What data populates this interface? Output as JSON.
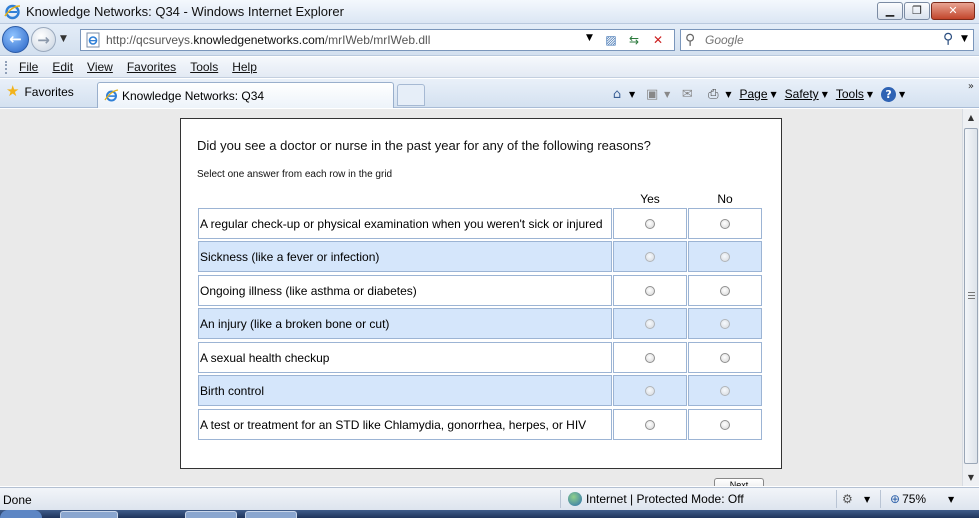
{
  "window": {
    "title": "Knowledge Networks: Q34 - Windows Internet Explorer",
    "min_glyph": "▁",
    "max_glyph": "❐",
    "close_glyph": "✕"
  },
  "address": {
    "url_prefix": "http://qcsurveys.",
    "url_domain": "knowledgenetworks.com",
    "url_path": "/mrIWeb/mrIWeb.dll",
    "search_placeholder": "Google"
  },
  "menu": [
    "File",
    "Edit",
    "View",
    "Favorites",
    "Tools",
    "Help"
  ],
  "favorites_label": "Favorites",
  "tab_title": "Knowledge Networks: Q34",
  "commands": {
    "page": "Page",
    "safety": "Safety",
    "tools": "Tools"
  },
  "survey": {
    "question": "Did you see a doctor or nurse in the past year for any of the following reasons?",
    "instruction": "Select one answer from each row in the grid",
    "columns": [
      "Yes",
      "No"
    ],
    "rows": [
      "A regular check-up or physical examination when you weren't sick or injured",
      "Sickness (like a fever or infection)",
      "Ongoing illness (like asthma or diabetes)",
      "An injury (like a broken bone or cut)",
      "A sexual health checkup",
      "Birth control",
      "A test or treatment for an STD like Chlamydia, gonorrhea, herpes, or HIV"
    ],
    "next_label": "Next"
  },
  "statusbar": {
    "status": "Done",
    "zone": "Internet | Protected Mode: Off",
    "zoom": "75%"
  },
  "colors": {
    "row_highlight": "#d5e6fb",
    "grid_border": "#9cb4d4"
  }
}
